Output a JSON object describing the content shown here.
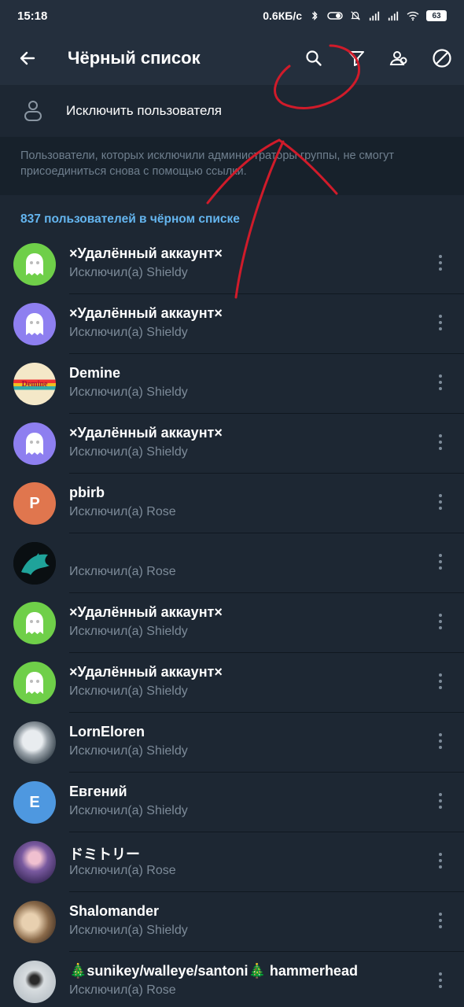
{
  "status_bar": {
    "time": "15:18",
    "network_speed": "0.6КБ/с",
    "battery": "63"
  },
  "app_bar": {
    "title": "Чёрный список"
  },
  "exclude": {
    "label": "Исключить пользователя"
  },
  "info": {
    "text": "Пользователи, которых исключили администраторы группы, не смогут присоединиться снова с помощью ссылки."
  },
  "list": {
    "header": "837 пользователей в чёрном списке",
    "items": [
      {
        "name": "×Удалённый аккаунт×",
        "subtitle": "Исключил(а) Shieldy",
        "avatar_type": "ghost",
        "avatar_color": "#6fcf49",
        "initial": ""
      },
      {
        "name": "×Удалённый аккаунт×",
        "subtitle": "Исключил(а) Shieldy",
        "avatar_type": "ghost",
        "avatar_color": "#8e7ff0",
        "initial": ""
      },
      {
        "name": "Demine",
        "subtitle": "Исключил(а) Shieldy",
        "avatar_type": "photo-demine",
        "avatar_color": "#f4e8c8",
        "initial": "Demine"
      },
      {
        "name": "×Удалённый аккаунт×",
        "subtitle": "Исключил(а) Shieldy",
        "avatar_type": "ghost",
        "avatar_color": "#8e7ff0",
        "initial": ""
      },
      {
        "name": "pbirb",
        "subtitle": "Исключил(а) Rose",
        "avatar_type": "letter",
        "avatar_color": "#e0764e",
        "initial": "P"
      },
      {
        "name": "",
        "subtitle": "Исключил(а) Rose",
        "avatar_type": "photo-dragon",
        "avatar_color": "#0a0f12",
        "initial": ""
      },
      {
        "name": "×Удалённый аккаунт×",
        "subtitle": "Исключил(а) Shieldy",
        "avatar_type": "ghost",
        "avatar_color": "#6fcf49",
        "initial": ""
      },
      {
        "name": "×Удалённый аккаунт×",
        "subtitle": "Исключил(а) Shieldy",
        "avatar_type": "ghost",
        "avatar_color": "#6fcf49",
        "initial": ""
      },
      {
        "name": "LornEloren",
        "subtitle": "Исключил(а) Shieldy",
        "avatar_type": "photo-gray",
        "avatar_color": "#9aa3aa",
        "initial": ""
      },
      {
        "name": "Евгений",
        "subtitle": "Исключил(а) Shieldy",
        "avatar_type": "letter",
        "avatar_color": "#4e98e0",
        "initial": "E"
      },
      {
        "name": "ドミトリー",
        "subtitle": "Исключил(а) Rose",
        "avatar_type": "photo-purple",
        "avatar_color": "#5a4a7a",
        "initial": ""
      },
      {
        "name": "Shalomander",
        "subtitle": "Исключил(а) Shieldy",
        "avatar_type": "photo-brown",
        "avatar_color": "#8a6a4a",
        "initial": ""
      },
      {
        "name": "🎄sunikey/walleye/santoni🎄 hammerhead",
        "subtitle": "Исключил(а) Rose",
        "avatar_type": "photo-light",
        "avatar_color": "#d8dde0",
        "initial": ""
      }
    ]
  },
  "colors": {
    "background": "#1d2733",
    "bar": "#242f3d",
    "accent": "#64b5ef",
    "annotation": "#d01b2a"
  },
  "icons": {
    "back": "arrow-left-icon",
    "search": "search-icon",
    "filter": "filter-icon",
    "admins": "users-icon",
    "blocked": "block-icon",
    "exclude": "person-outline-icon",
    "more": "more-vertical-icon"
  }
}
